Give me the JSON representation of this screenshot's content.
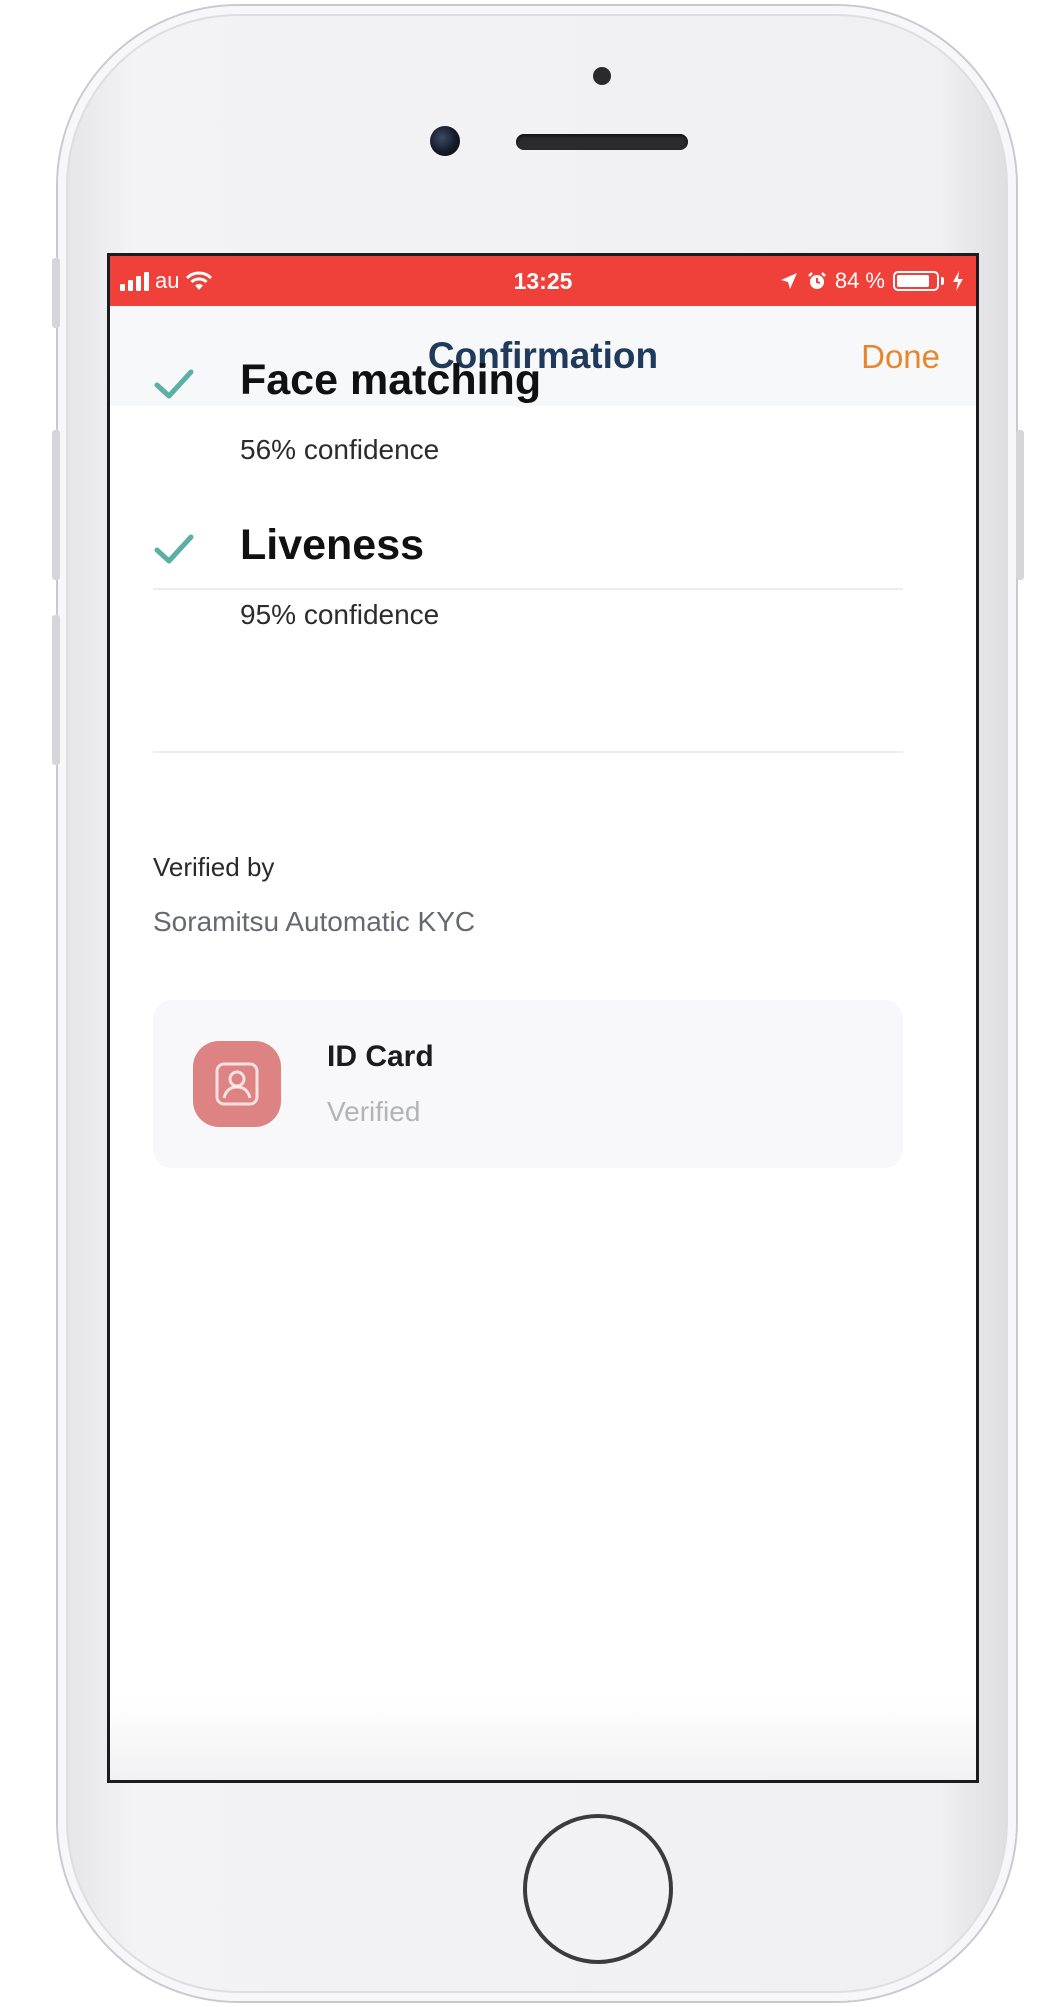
{
  "status_bar": {
    "carrier": "au",
    "time": "13:25",
    "battery_percent": "84 %",
    "battery_level": 0.84,
    "color": "#f0403a"
  },
  "nav": {
    "title": "Confirmation",
    "done_label": "Done",
    "title_color": "#203a5c",
    "accent_color": "#e8862e"
  },
  "checks": [
    {
      "title": "Face matching",
      "subtitle": "56% confidence",
      "icon": "checkmark-icon",
      "color": "#5bb0a4"
    },
    {
      "title": "Liveness",
      "subtitle": "95% confidence",
      "icon": "checkmark-icon",
      "color": "#5bb0a4"
    }
  ],
  "verified_by": {
    "label": "Verified by",
    "value": "Soramitsu Automatic KYC"
  },
  "documents": [
    {
      "title": "ID Card",
      "status": "Verified",
      "icon": "id-card-icon",
      "icon_bg": "#dd8383"
    }
  ]
}
